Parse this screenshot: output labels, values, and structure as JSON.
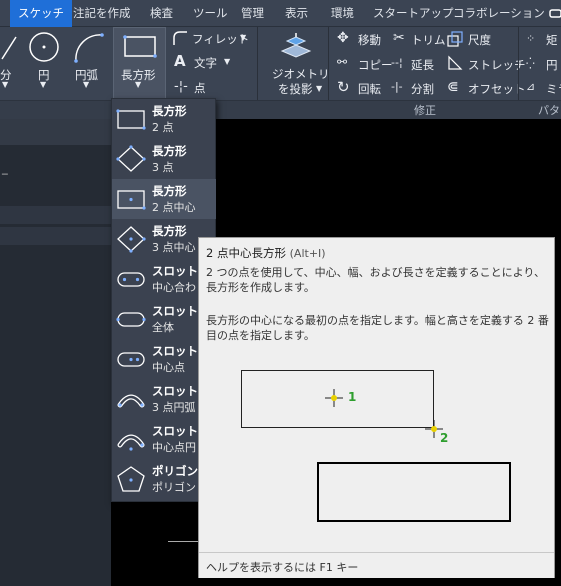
{
  "tabs": [
    "スケッチ",
    "注記を作成",
    "検査",
    "ツール",
    "管理",
    "表示",
    "環境",
    "スタートアップ",
    "コラボレーション"
  ],
  "ribbon": {
    "left_labels": [
      "分",
      "円",
      "円弧"
    ],
    "rect_label": "長方形",
    "fillet_label": "フィレット",
    "text_label": "文字",
    "point_label": "点",
    "project_label_1": "ジオメトリ",
    "project_label_2": "を投影",
    "move": "移動",
    "trim": "トリム",
    "dimension": "尺度",
    "copy": "コピー",
    "extend": "延長",
    "stretch": "ストレッチ",
    "rotate": "回転",
    "split": "分割",
    "offset": "オフセット",
    "right_1": "矩",
    "right_2": "円",
    "right_3": "ミラ",
    "panel_modify": "修正",
    "panel_pattern": "パター"
  },
  "dropdown": [
    {
      "l1": "長方形",
      "l2": "2 点"
    },
    {
      "l1": "長方形",
      "l2": "3 点"
    },
    {
      "l1": "長方形",
      "l2": "2 点中心"
    },
    {
      "l1": "長方形",
      "l2": "3 点中心"
    },
    {
      "l1": "スロット",
      "l2": "中心合わ"
    },
    {
      "l1": "スロット",
      "l2": "全体"
    },
    {
      "l1": "スロット",
      "l2": "中心点"
    },
    {
      "l1": "スロット",
      "l2": "3 点円弧"
    },
    {
      "l1": "スロット",
      "l2": "中心点円"
    },
    {
      "l1": "ポリゴン",
      "l2": "ポリゴン"
    }
  ],
  "tooltip": {
    "title": "2 点中心長方形",
    "shortcut": "(Alt+I)",
    "desc1": "2 つの点を使用して、中心、幅、および長さを定義することにより、長方形を作成します。",
    "desc2": "長方形の中心になる最初の点を指定します。幅と高さを定義する 2 番目の点を指定します。",
    "label_1": "1",
    "label_2": "2",
    "footer": "ヘルプを表示するには F1 キー"
  },
  "left_panel": {
    "dash": "_"
  },
  "colors": {
    "accent": "#1f6fd8",
    "ribbon_bg": "#3b4453",
    "tooltip_bg": "#efefef",
    "marker_green": "#2e9e2e",
    "marker_yellow": "#e8d000"
  }
}
